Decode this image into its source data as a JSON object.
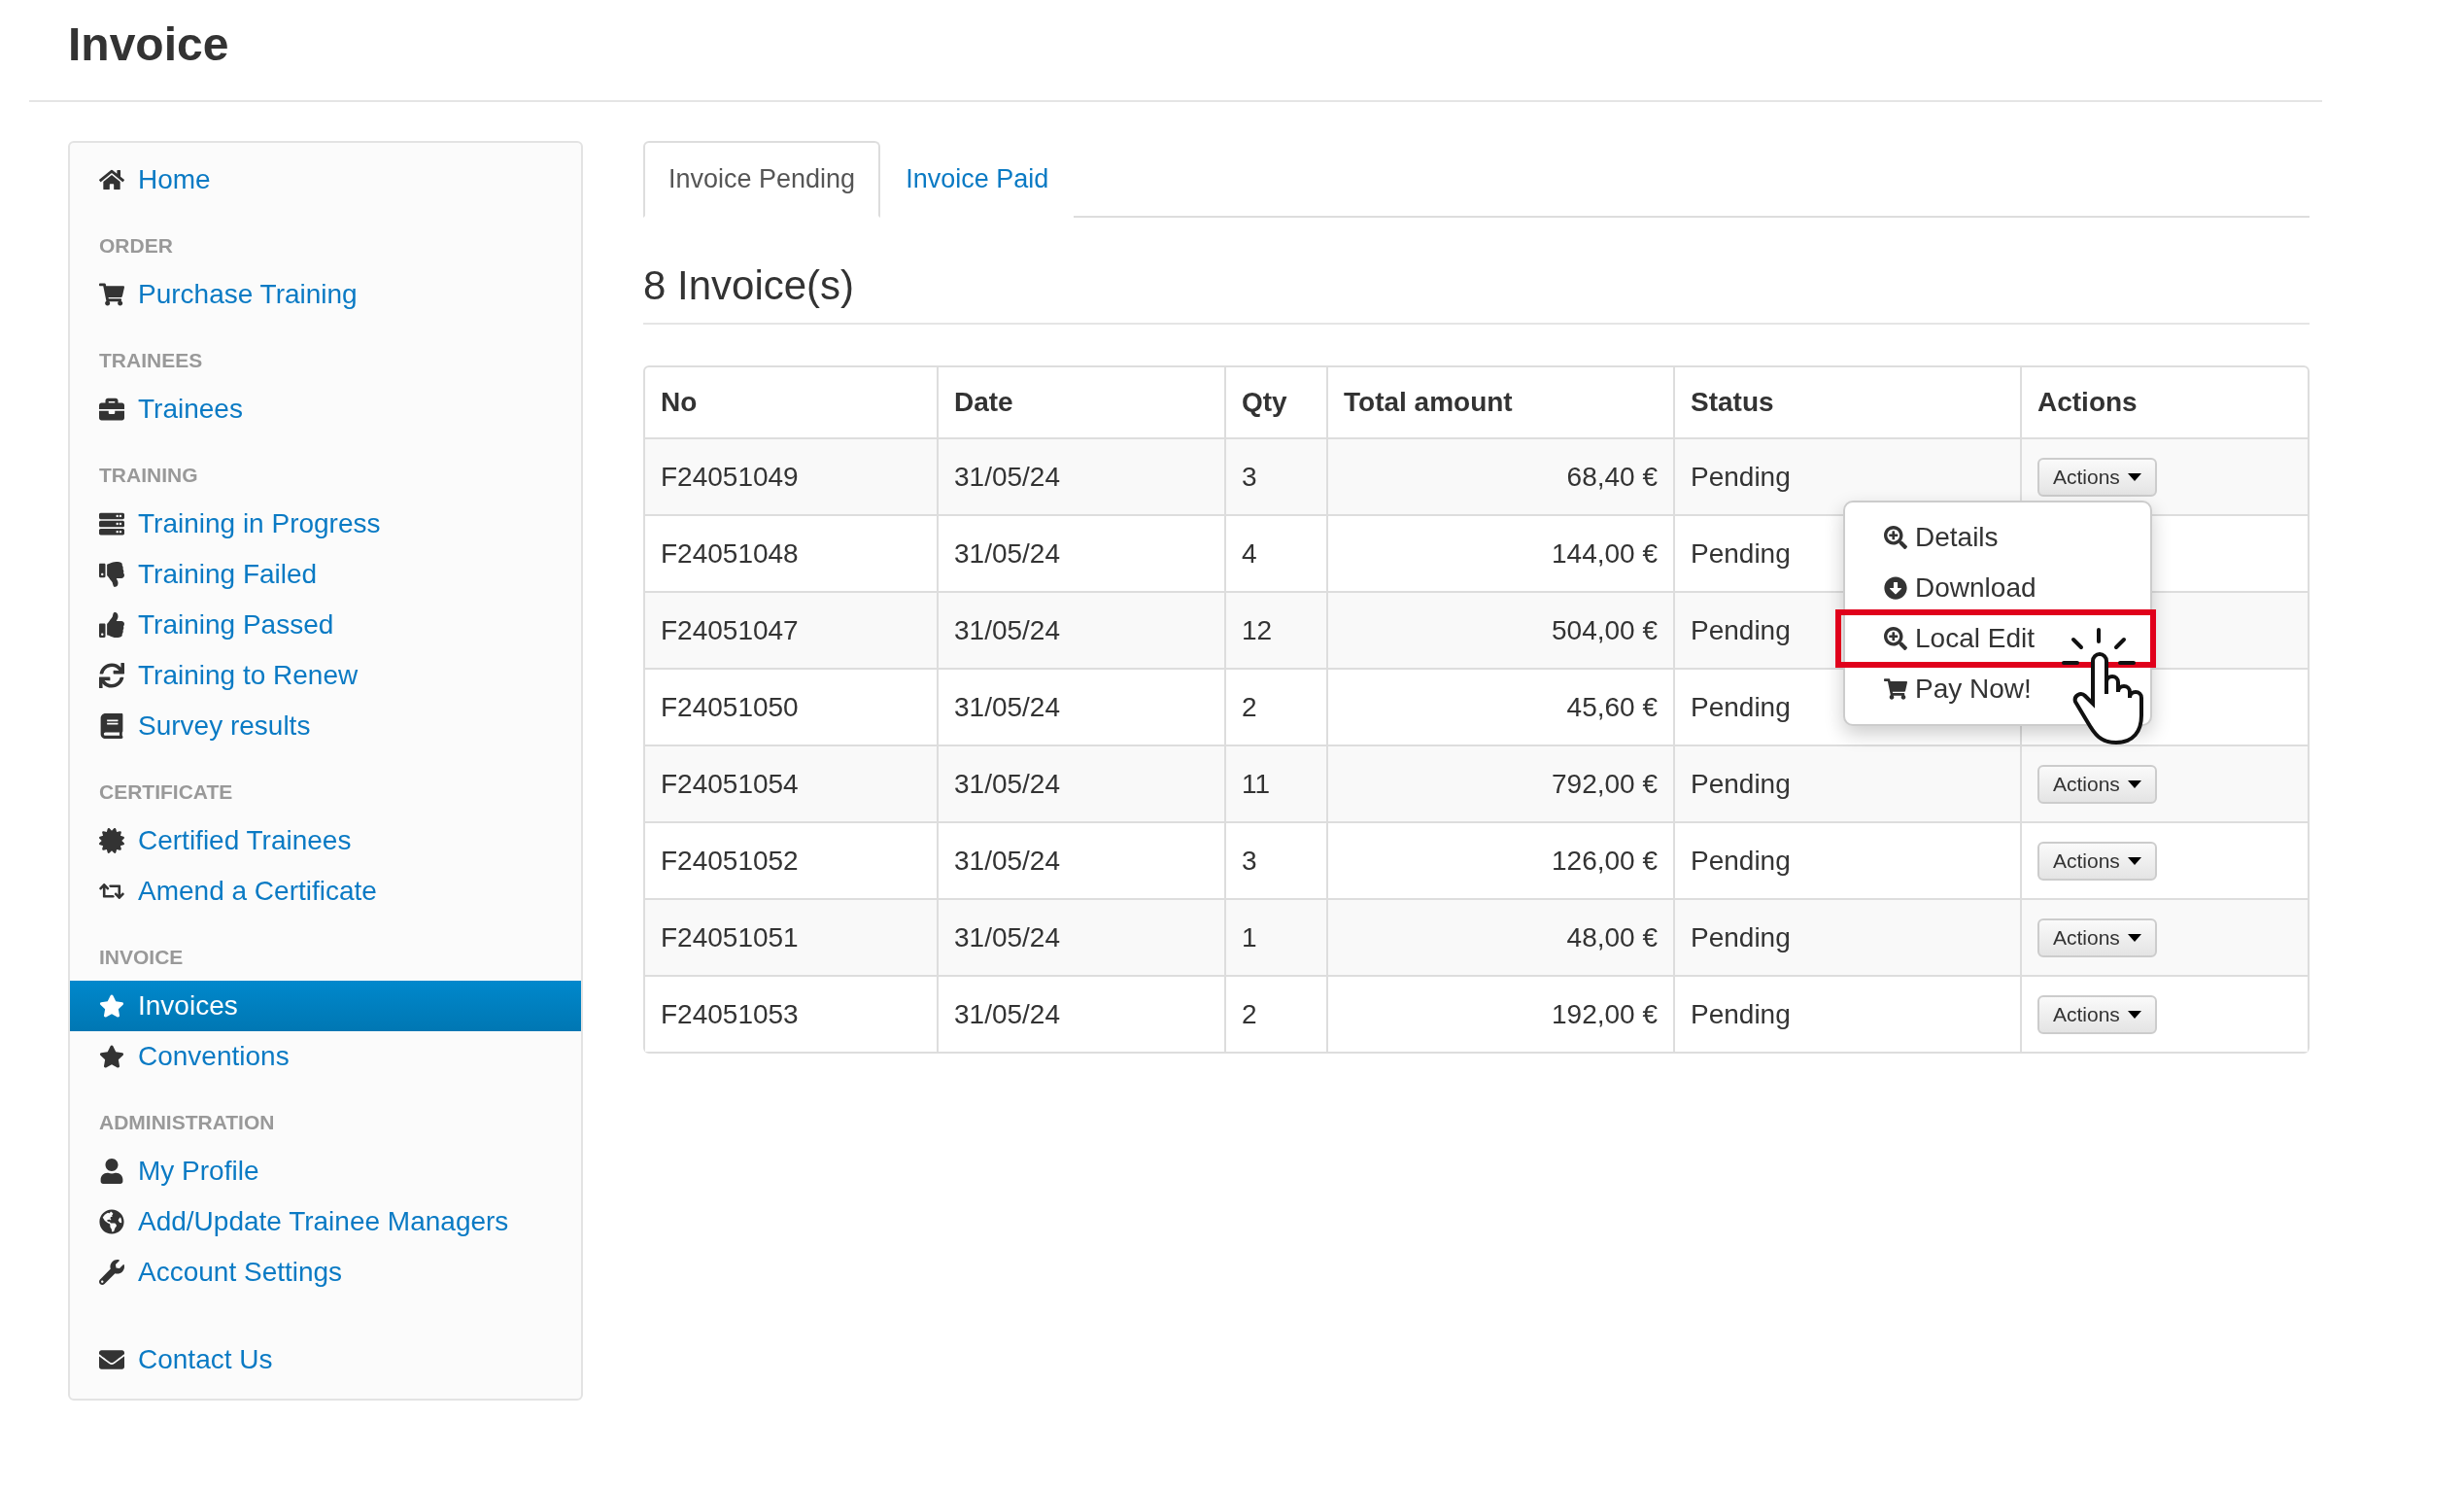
{
  "page": {
    "title": "Invoice"
  },
  "sidebar": {
    "top_item": {
      "label": "Home",
      "selected": false
    },
    "sections": [
      {
        "header": "ORDER",
        "items": [
          {
            "label": "Purchase Training",
            "selected": false
          }
        ]
      },
      {
        "header": "TRAINEES",
        "items": [
          {
            "label": "Trainees",
            "selected": false
          }
        ]
      },
      {
        "header": "TRAINING",
        "items": [
          {
            "label": "Training in Progress",
            "selected": false
          },
          {
            "label": "Training Failed",
            "selected": false
          },
          {
            "label": "Training Passed",
            "selected": false
          },
          {
            "label": "Training to Renew",
            "selected": false
          },
          {
            "label": "Survey results",
            "selected": false
          }
        ]
      },
      {
        "header": "CERTIFICATE",
        "items": [
          {
            "label": "Certified Trainees",
            "selected": false
          },
          {
            "label": "Amend a Certificate",
            "selected": false
          }
        ]
      },
      {
        "header": "INVOICE",
        "items": [
          {
            "label": "Invoices",
            "selected": true
          },
          {
            "label": "Conventions",
            "selected": false
          }
        ]
      },
      {
        "header": "ADMINISTRATION",
        "items": [
          {
            "label": "My Profile",
            "selected": false
          },
          {
            "label": "Add/Update Trainee Managers",
            "selected": false
          },
          {
            "label": "Account Settings",
            "selected": false
          }
        ]
      }
    ],
    "footer_item": {
      "label": "Contact Us",
      "selected": false
    }
  },
  "tabs": [
    {
      "label": "Invoice Pending",
      "selected": true
    },
    {
      "label": "Invoice Paid",
      "selected": false
    }
  ],
  "heading": "8 Invoice(s)",
  "table": {
    "columns": [
      "No",
      "Date",
      "Qty",
      "Total amount",
      "Status",
      "Actions"
    ],
    "rows": [
      {
        "no": "F24051049",
        "date": "31/05/24",
        "qty": "3",
        "total": "68,40 €",
        "status": "Pending",
        "action": "Actions"
      },
      {
        "no": "F24051048",
        "date": "31/05/24",
        "qty": "4",
        "total": "144,00 €",
        "status": "Pending"
      },
      {
        "no": "F24051047",
        "date": "31/05/24",
        "qty": "12",
        "total": "504,00 €",
        "status": "Pending"
      },
      {
        "no": "F24051050",
        "date": "31/05/24",
        "qty": "2",
        "total": "45,60 €",
        "status": "Pending"
      },
      {
        "no": "F24051054",
        "date": "31/05/24",
        "qty": "11",
        "total": "792,00 €",
        "status": "Pending",
        "action": "Actions"
      },
      {
        "no": "F24051052",
        "date": "31/05/24",
        "qty": "3",
        "total": "126,00 €",
        "status": "Pending",
        "action": "Actions"
      },
      {
        "no": "F24051051",
        "date": "31/05/24",
        "qty": "1",
        "total": "48,00 €",
        "status": "Pending",
        "action": "Actions"
      },
      {
        "no": "F24051053",
        "date": "31/05/24",
        "qty": "2",
        "total": "192,00 €",
        "status": "Pending",
        "action": "Actions"
      }
    ]
  },
  "actions_menu": {
    "items": [
      {
        "label": "Details",
        "highlighted": false
      },
      {
        "label": "Download",
        "highlighted": false
      },
      {
        "label": "Local Edit",
        "highlighted": true
      },
      {
        "label": "Pay Now!",
        "highlighted": false
      }
    ]
  }
}
